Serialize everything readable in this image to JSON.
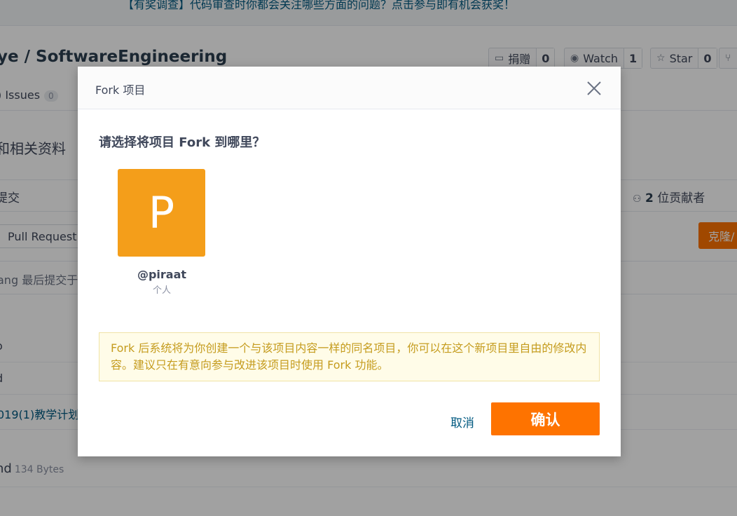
{
  "background": {
    "survey_banner": "【有奖调查】代码审查时你都会关注哪些方面的问题？点击参与即有机会获奖！",
    "repo_title": "ye / SoftwareEngineering",
    "actions": [
      {
        "label": "捐赠",
        "count": "0",
        "icon": "donate-icon"
      },
      {
        "label": "Watch",
        "count": "1",
        "icon": "eye-icon"
      },
      {
        "label": "Star",
        "count": "0",
        "icon": "star-icon"
      }
    ],
    "fork_icon": "fork-icon",
    "tabs": {
      "issues_label": ") Issues",
      "issues_count": "0"
    },
    "description": "和相关资料",
    "stats": {
      "commits": "提交",
      "contributors_count": "2",
      "contributors_label": "位贡献者"
    },
    "pull_request_label": "Pull Request",
    "clone_label": "克隆/",
    "last_commit": "ang 最后提交于",
    "files": [
      {
        "name": "o"
      },
      {
        "name": "d"
      },
      {
        "name": "019(1)教学计划"
      }
    ],
    "readme": {
      "name": "nd",
      "size": "134 Bytes"
    }
  },
  "modal": {
    "title": "Fork 项目",
    "question": "请选择将项目 Fork 到哪里？",
    "namespace": {
      "avatar_letter": "P",
      "name": "@piraat",
      "type": "个人",
      "avatar_color": "#f49e1a"
    },
    "notice": "Fork 后系统将为你创建一个与该项目内容一样的同名项目，你可以在这个新项目里自由的修改内容。建议只在有意向参与改进该项目时使用 Fork 功能。",
    "cancel_label": "取消",
    "confirm_label": "确认",
    "confirm_color": "#fe7300"
  }
}
